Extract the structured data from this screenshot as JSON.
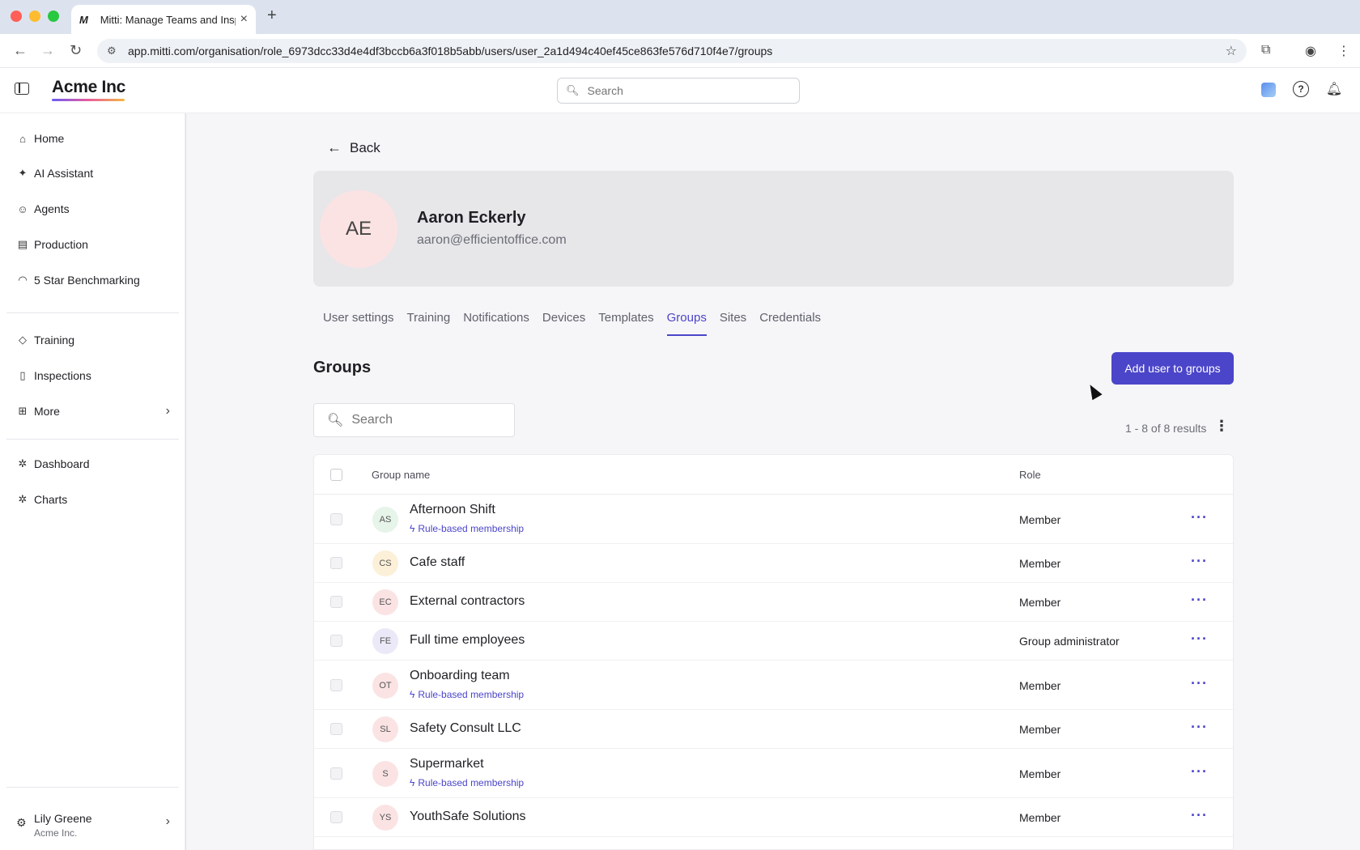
{
  "browser": {
    "tab_title": "Mitti: Manage Teams and Insp",
    "tab_favicon": "M",
    "url": "app.mitti.com/organisation/role_6973dcc33d4e4df3bccb6a3f018b5abb/users/user_2a1d494c40ef45ce863fe576d710f4e7/groups"
  },
  "header": {
    "brand": "Acme Inc",
    "search_placeholder": "Search"
  },
  "sidebar": {
    "items": [
      {
        "label": "Home",
        "icon": "home-icon"
      },
      {
        "label": "AI Assistant",
        "icon": "sparkle-icon"
      },
      {
        "label": "Agents",
        "icon": "robot-icon"
      },
      {
        "label": "Production",
        "icon": "building-icon"
      },
      {
        "label": "5 Star Benchmarking",
        "icon": "gauge-icon"
      },
      {
        "label": "Training",
        "icon": "graduation-cap-icon"
      },
      {
        "label": "Inspections",
        "icon": "clipboard-icon"
      },
      {
        "label": "More",
        "icon": "grid-icon"
      },
      {
        "label": "Dashboard",
        "icon": "puzzle-icon"
      },
      {
        "label": "Charts",
        "icon": "puzzle-icon"
      }
    ],
    "user": {
      "name": "Lily Greene",
      "org": "Acme Inc."
    }
  },
  "main": {
    "back_label": "Back",
    "profile": {
      "initials": "AE",
      "name": "Aaron Eckerly",
      "email": "aaron@efficientoffice.com"
    },
    "tabs": [
      "User settings",
      "Training",
      "Notifications",
      "Devices",
      "Templates",
      "Groups",
      "Sites",
      "Credentials"
    ],
    "active_tab": "Groups",
    "section_title": "Groups",
    "add_button": "Add user to groups",
    "list_search_placeholder": "Search",
    "results_text": "1 - 8 of 8 results",
    "table": {
      "columns": [
        "Group name",
        "Role"
      ],
      "rows": [
        {
          "initials": "AS",
          "name": "Afternoon Shift",
          "badge": "Rule-based membership",
          "role": "Member",
          "avatar_color": "#e6f4ea"
        },
        {
          "initials": "CS",
          "name": "Cafe staff",
          "badge": "",
          "role": "Member",
          "avatar_color": "#fdf0d8"
        },
        {
          "initials": "EC",
          "name": "External contractors",
          "badge": "",
          "role": "Member",
          "avatar_color": "#fbe3e4"
        },
        {
          "initials": "FE",
          "name": "Full time employees",
          "badge": "",
          "role": "Group administrator",
          "avatar_color": "#ebe9f8"
        },
        {
          "initials": "OT",
          "name": "Onboarding team",
          "badge": "Rule-based membership",
          "role": "Member",
          "avatar_color": "#fbe3e4"
        },
        {
          "initials": "SL",
          "name": "Safety Consult LLC",
          "badge": "",
          "role": "Member",
          "avatar_color": "#fbe3e4"
        },
        {
          "initials": "S",
          "name": "Supermarket",
          "badge": "Rule-based membership",
          "role": "Member",
          "avatar_color": "#fbe3e4"
        },
        {
          "initials": "YS",
          "name": "YouthSafe Solutions",
          "badge": "",
          "role": "Member",
          "avatar_color": "#fbe3e4"
        }
      ]
    }
  },
  "colors": {
    "accent": "#4b45c9",
    "page_bg": "#f6f5f8",
    "card_bg": "#e7e6e9"
  }
}
